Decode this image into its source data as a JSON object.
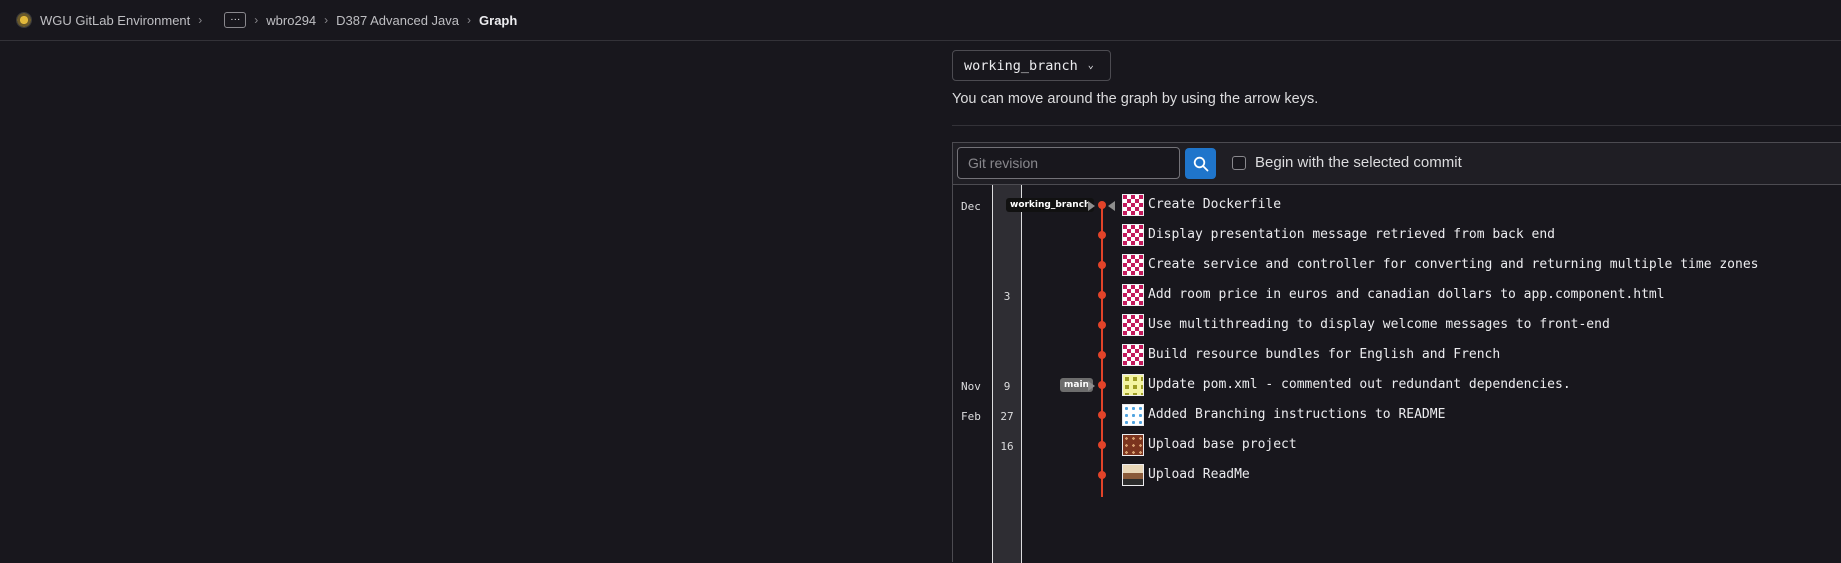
{
  "breadcrumb": {
    "app": "WGU GitLab Environment",
    "ellipsis": "···",
    "user": "wbro294",
    "project": "D387 Advanced Java",
    "current": "Graph"
  },
  "ref_selector": {
    "value": "working_branch"
  },
  "hint": "You can move around the graph by using the arrow keys.",
  "toolbar": {
    "revision_placeholder": "Git revision",
    "begin_label": "Begin with the selected commit",
    "begin_checked": false
  },
  "graph": {
    "months": [
      "Dec",
      "Nov",
      "Feb"
    ],
    "days": [
      "3",
      "9",
      "27",
      "16"
    ],
    "refs": {
      "working_branch": "working_branch",
      "main": "main"
    },
    "colors": {
      "line": "#e24329",
      "button": "#1f75cb"
    },
    "commits": [
      "Create Dockerfile",
      "Display presentation message retrieved from back end",
      "Create service and controller for converting and returning multiple time zones",
      "Add room price in euros and canadian dollars to app.component.html",
      "Use multithreading to display welcome messages to front-end",
      "Build resource bundles for English and French",
      "Update pom.xml - commented out redundant dependencies.",
      "Added Branching instructions to README",
      "Upload base project",
      "Upload ReadMe"
    ]
  }
}
